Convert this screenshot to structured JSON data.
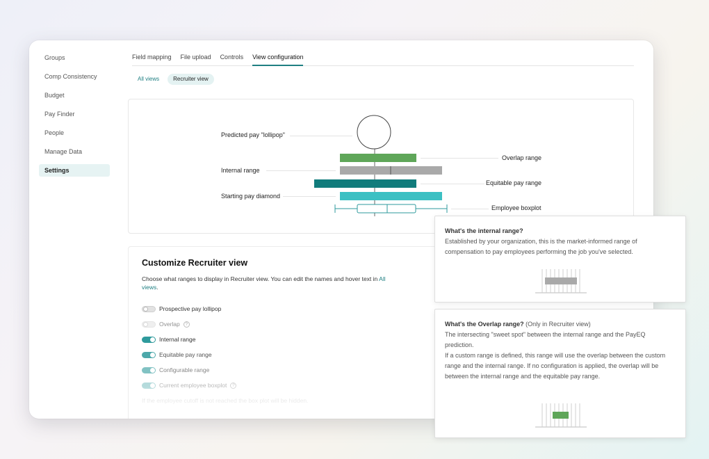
{
  "sidebar": {
    "items": [
      {
        "label": "Groups"
      },
      {
        "label": "Comp Consistency"
      },
      {
        "label": "Budget"
      },
      {
        "label": "Pay Finder"
      },
      {
        "label": "People"
      },
      {
        "label": "Manage Data"
      },
      {
        "label": "Settings",
        "active": true
      }
    ]
  },
  "tabs": [
    {
      "label": "Field mapping"
    },
    {
      "label": "File upload"
    },
    {
      "label": "Controls"
    },
    {
      "label": "View configuration",
      "active": true
    }
  ],
  "view_chips": [
    {
      "label": "All views"
    },
    {
      "label": "Recruiter view",
      "active": true
    }
  ],
  "diagram": {
    "lollipop_label": "Predicted pay \"lollipop\"",
    "internal_label": "Internal range",
    "starting_label": "Starting pay diamond",
    "overlap_label": "Overlap range",
    "equitable_label": "Equitable pay range",
    "boxplot_label": "Employee boxplot"
  },
  "customize": {
    "title": "Customize Recruiter view",
    "desc_text": "Choose what ranges to display in Recruiter view. You can edit the names and hover text in",
    "desc_link": "All views",
    "desc_end": ".",
    "toggles": [
      {
        "label": "Prospective pay lollipop",
        "state": "off"
      },
      {
        "label": "Overlap",
        "state": "off"
      },
      {
        "label": "Internal range",
        "state": "on"
      },
      {
        "label": "Equitable pay range",
        "state": "on"
      },
      {
        "label": "Configurable range",
        "state": "on"
      },
      {
        "label": "Current employee boxplot",
        "state": "on"
      }
    ],
    "cutoff_note": "If the employee cutoff is not reached the box plot will be hidden."
  },
  "tooltips": {
    "internal": {
      "title": "What's the internal range?",
      "body": "Established by your organization, this is the market-informed range of compensation to pay employees performing the job you've selected."
    },
    "overlap": {
      "title": "What's the Overlap range?",
      "title_suffix": " (Only in Recruiter view)",
      "body1": "The intersecting \"sweet spot\" between the internal range and the PayEQ prediction.",
      "body2": "If a custom range is defined, this range will use the overlap between the custom range and the internal range. If no configuration is applied, the overlap will be between the internal range and the equitable pay range."
    }
  },
  "colors": {
    "accent": "#1f7f82",
    "overlap_bar": "#5fa659",
    "internal_bar": "#a9a9a9",
    "equitable_bar": "#117c7c",
    "starting_bar": "#3cc0c3"
  }
}
